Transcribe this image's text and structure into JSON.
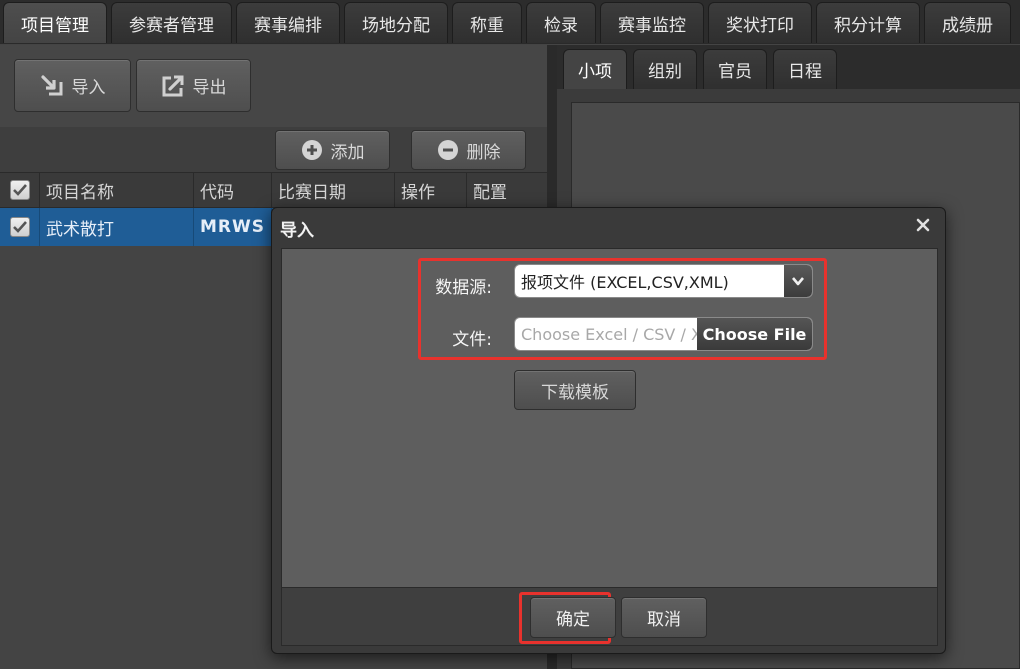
{
  "top_tabs": [
    {
      "label": "项目管理",
      "active": true
    },
    {
      "label": "参赛者管理"
    },
    {
      "label": "赛事编排"
    },
    {
      "label": "场地分配"
    },
    {
      "label": "称重"
    },
    {
      "label": "检录"
    },
    {
      "label": "赛事监控"
    },
    {
      "label": "奖状打印"
    },
    {
      "label": "积分计算"
    },
    {
      "label": "成绩册"
    }
  ],
  "toolbar": {
    "import_label": "导入",
    "export_label": "导出"
  },
  "actions": {
    "add_label": "添加",
    "delete_label": "删除"
  },
  "grid": {
    "headers": [
      "项目名称",
      "代码",
      "比赛日期",
      "操作",
      "配置"
    ],
    "rows": [
      {
        "name": "武术散打",
        "code": "MRWS",
        "selected": true
      }
    ]
  },
  "right_tabs": [
    {
      "label": "小项",
      "active": true
    },
    {
      "label": "组别"
    },
    {
      "label": "官员"
    },
    {
      "label": "日程"
    }
  ],
  "modal": {
    "title": "导入",
    "source_label": "数据源:",
    "source_value": "报项文件 (EXCEL,CSV,XML)",
    "file_label": "文件:",
    "file_placeholder": "Choose Excel / CSV / XML",
    "file_button": "Choose File",
    "template_button": "下载模板",
    "ok_button": "确定",
    "cancel_button": "取消"
  },
  "colors": {
    "selected_row": "#1f5d96",
    "highlight": "#e8322d",
    "panel": "#444444"
  }
}
